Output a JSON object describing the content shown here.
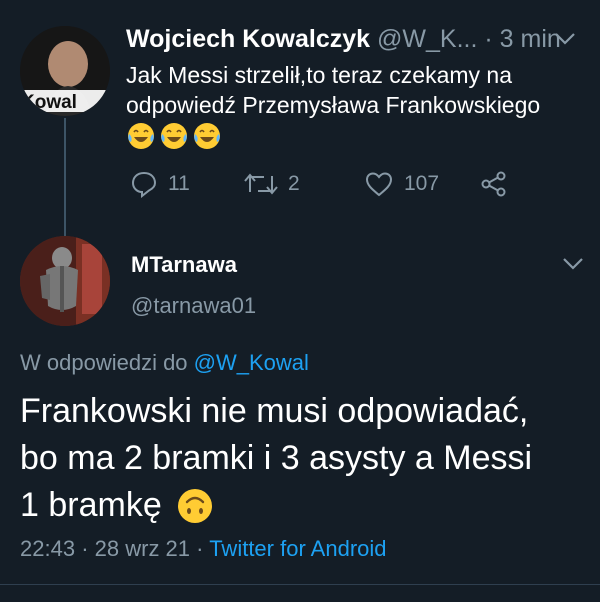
{
  "tweet1": {
    "author_name": "Wojciech Kowalczyk",
    "author_handle": "@W_K...",
    "separator": "·",
    "time": "3 min",
    "text_line1": "Jak Messi strzelił,to teraz czekamy na",
    "text_line2": "odpowiedź Przemysława Frankowskiego",
    "emojis": "😂😂😂",
    "avatar_text": "Kowal",
    "reply_count": "11",
    "retweet_count": "2",
    "like_count": "107"
  },
  "tweet2": {
    "author_name": "MTarnawa",
    "author_handle": "@tarnawa01",
    "reply_prefix": "W odpowiedzi do",
    "reply_handle": "@W_Kowal",
    "text_line1": "Frankowski nie musi odpowiadać,",
    "text_line2": "bo ma 2 bramki i 3 asysty a Messi",
    "text_line3": "1 bramkę",
    "emoji": "🙃",
    "time": "22:43",
    "separator1": "·",
    "date": "28 wrz 21",
    "separator2": "·",
    "source": "Twitter for Android"
  },
  "icons": {
    "reply": "reply-icon",
    "retweet": "retweet-icon",
    "like": "like-icon",
    "share": "share-icon",
    "chevron": "chevron-down-icon"
  },
  "colors": {
    "background": "#141d26",
    "muted": "#8899a6",
    "link": "#1da1f2",
    "thread_line": "#3d5466",
    "emoji_yellow": "#ffcc33"
  }
}
